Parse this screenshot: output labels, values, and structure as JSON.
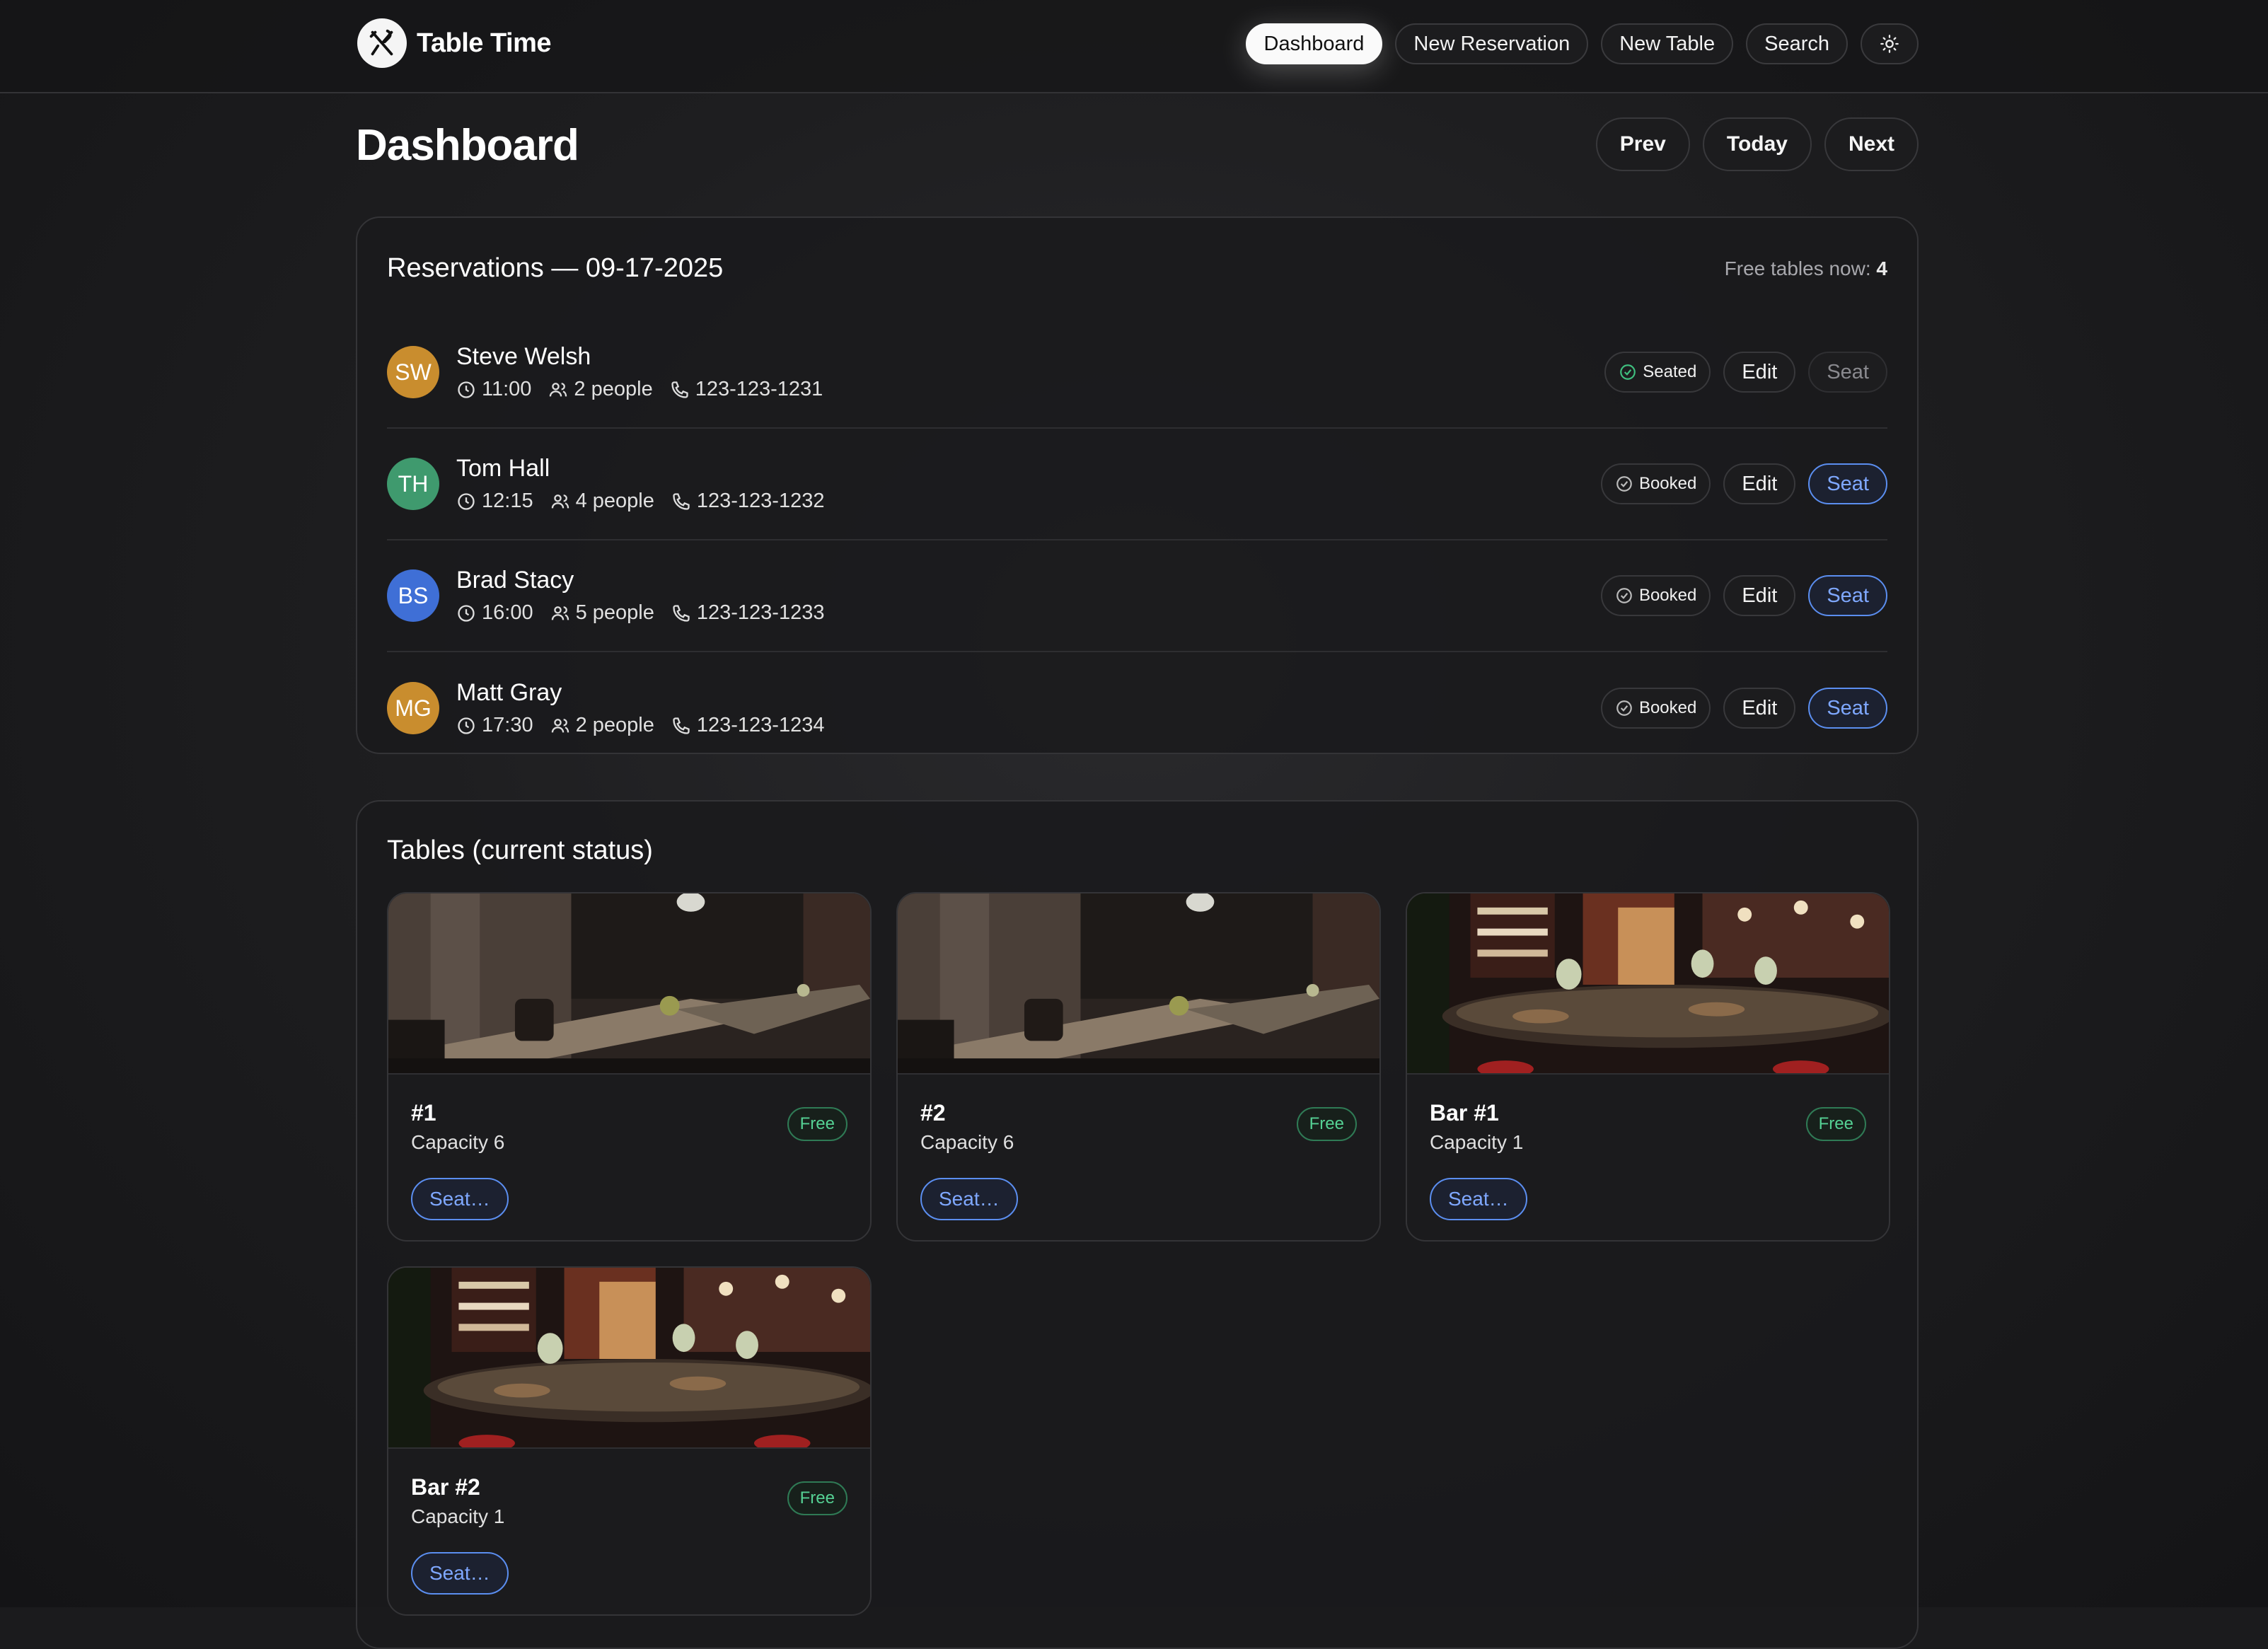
{
  "app": {
    "name": "Table Time"
  },
  "nav": {
    "items": [
      {
        "label": "Dashboard",
        "active": true
      },
      {
        "label": "New Reservation",
        "active": false
      },
      {
        "label": "New Table",
        "active": false
      },
      {
        "label": "Search",
        "active": false
      }
    ],
    "theme_icon": "sun-icon"
  },
  "page": {
    "title": "Dashboard"
  },
  "date_nav": {
    "prev": "Prev",
    "today": "Today",
    "next": "Next"
  },
  "reservations": {
    "title": "Reservations — 09-17-2025",
    "free_label": "Free tables now:",
    "free_count": "4",
    "rows": [
      {
        "initials": "SW",
        "avatar_color": "#c98d2e",
        "name": "Steve Welsh",
        "time": "11:00",
        "people": "2 people",
        "phone": "123-123-1231",
        "status": "Seated",
        "edit": "Edit",
        "seat": "Seat",
        "seat_enabled": false
      },
      {
        "initials": "TH",
        "avatar_color": "#3f9a6e",
        "name": "Tom Hall",
        "time": "12:15",
        "people": "4 people",
        "phone": "123-123-1232",
        "status": "Booked",
        "edit": "Edit",
        "seat": "Seat",
        "seat_enabled": true
      },
      {
        "initials": "BS",
        "avatar_color": "#3f6fd6",
        "name": "Brad Stacy",
        "time": "16:00",
        "people": "5 people",
        "phone": "123-123-1233",
        "status": "Booked",
        "edit": "Edit",
        "seat": "Seat",
        "seat_enabled": true
      },
      {
        "initials": "MG",
        "avatar_color": "#c98d2e",
        "name": "Matt Gray",
        "time": "17:30",
        "people": "2 people",
        "phone": "123-123-1234",
        "status": "Booked",
        "edit": "Edit",
        "seat": "Seat",
        "seat_enabled": true
      }
    ]
  },
  "tables": {
    "title": "Tables (current status)",
    "items": [
      {
        "name": "#1",
        "capacity": "Capacity 6",
        "status": "Free",
        "action": "Seat…",
        "photo": "dining-room"
      },
      {
        "name": "#2",
        "capacity": "Capacity 6",
        "status": "Free",
        "action": "Seat…",
        "photo": "dining-room"
      },
      {
        "name": "Bar #1",
        "capacity": "Capacity 1",
        "status": "Free",
        "action": "Seat…",
        "photo": "bar"
      },
      {
        "name": "Bar #2",
        "capacity": "Capacity 1",
        "status": "Free",
        "action": "Seat…",
        "photo": "bar"
      }
    ]
  },
  "colors": {
    "accent_blue": "#7fa8ff",
    "free_green": "#55d194",
    "background": "#1b1b1d"
  }
}
